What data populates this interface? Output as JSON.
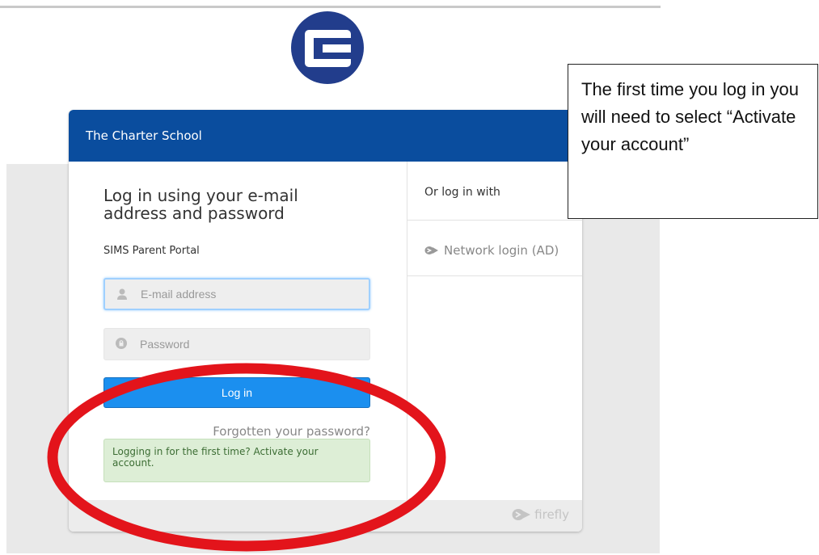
{
  "logo": {
    "icon": "charter-school-c-logo-icon",
    "color": "#223d8c"
  },
  "header": {
    "school_name": "The Charter School",
    "color": "#0a4d9e"
  },
  "login": {
    "heading": "Log in using your e-mail address and password",
    "portal_label": "SIMS Parent Portal",
    "email": {
      "placeholder": "E-mail address",
      "value": "",
      "icon": "user-icon"
    },
    "password": {
      "placeholder": "Password",
      "value": "",
      "icon": "lock-icon"
    },
    "login_button": "Log in",
    "forgot_link": "Forgotten your password?",
    "first_time_notice": "Logging in for the first time? Activate your account."
  },
  "alt_login": {
    "title": "Or log in with",
    "network_login": "Network login (AD)",
    "network_icon": "firefly-icon"
  },
  "footer": {
    "brand": "firefly",
    "icon": "firefly-icon"
  },
  "annotation": {
    "callout_text": "The first time you log in you will need to select “Activate your account”",
    "ring_color": "#e3141b"
  }
}
